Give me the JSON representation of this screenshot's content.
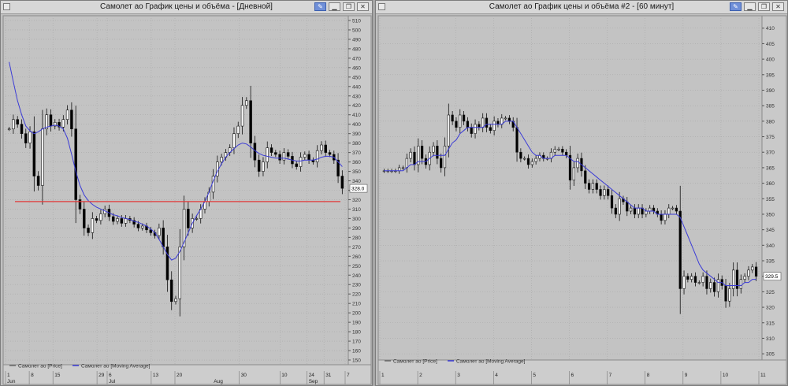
{
  "windows": [
    {
      "id": "left",
      "title": "Самолет ао График цены и объёма - [Дневной]",
      "buttons": [
        "pin-icon",
        "minimize-icon",
        "restore-icon",
        "close-icon"
      ]
    },
    {
      "id": "right",
      "title": "Самолет ао График цены и объёма #2 - [60 минут]",
      "buttons": [
        "pin-icon",
        "minimize-icon",
        "restore-icon",
        "close-icon"
      ]
    }
  ],
  "chart_data": [
    {
      "type": "line",
      "title": "",
      "ylim": [
        145,
        515
      ],
      "yticks": [
        150,
        160,
        170,
        180,
        190,
        200,
        210,
        220,
        230,
        240,
        250,
        260,
        270,
        280,
        290,
        300,
        310,
        320,
        330,
        340,
        350,
        360,
        370,
        380,
        390,
        400,
        410,
        420,
        430,
        440,
        450,
        460,
        470,
        480,
        490,
        500,
        510
      ],
      "x_tick_labels": [
        "1",
        "8",
        "15",
        "29",
        "6",
        "13",
        "20",
        "30",
        "10",
        "24",
        "31",
        "7"
      ],
      "x_month_labels": [
        "Jun",
        "Jul",
        "Aug",
        "Sep"
      ],
      "last_price_label": "328.0",
      "support_level": 318,
      "legend": [
        {
          "name": "Самолет ао [Price]",
          "color": "#6a6a6a"
        },
        {
          "name": "Самолет ао [Moving Average]",
          "color": "#3b3bd6"
        }
      ],
      "grid": true,
      "series": [
        {
          "name": "Самолет ао [Price]",
          "color": "#000000",
          "values": [
            395,
            405,
            400,
            390,
            380,
            392,
            345,
            335,
            395,
            410,
            398,
            402,
            397,
            405,
            415,
            395,
            320,
            310,
            290,
            285,
            300,
            298,
            305,
            310,
            302,
            297,
            300,
            295,
            300,
            298,
            294,
            290,
            292,
            288,
            285,
            282,
            290,
            270,
            235,
            212,
            215,
            270,
            310,
            290,
            300,
            300,
            310,
            318,
            328,
            345,
            360,
            365,
            370,
            375,
            390,
            398,
            420,
            425,
            380,
            362,
            350,
            360,
            375,
            370,
            368,
            362,
            370,
            366,
            358,
            355,
            365,
            368,
            362,
            360,
            372,
            378,
            370,
            368,
            362,
            345,
            332
          ]
        },
        {
          "name": "Самолет ао [Moving Average]",
          "color": "#3b3bd6",
          "values": [
            466,
            445,
            425,
            410,
            398,
            393,
            390,
            392,
            395,
            397,
            398,
            399,
            398,
            395,
            385,
            368,
            350,
            335,
            325,
            319,
            315,
            312,
            310,
            308,
            306,
            304,
            303,
            301,
            300,
            299,
            297,
            296,
            294,
            292,
            289,
            285,
            278,
            270,
            262,
            256,
            258,
            265,
            275,
            285,
            295,
            303,
            310,
            318,
            328,
            340,
            350,
            358,
            365,
            370,
            374,
            378,
            380,
            379,
            376,
            372,
            369,
            367,
            366,
            365,
            364,
            364,
            364,
            363,
            362,
            361,
            361,
            362,
            362,
            362,
            363,
            365,
            366,
            366,
            365,
            360,
            355
          ]
        }
      ]
    },
    {
      "type": "line",
      "title": "",
      "ylim": [
        303,
        414
      ],
      "yticks": [
        305,
        310,
        315,
        320,
        325,
        330,
        335,
        340,
        345,
        350,
        355,
        360,
        365,
        370,
        375,
        380,
        385,
        390,
        395,
        400,
        405,
        410
      ],
      "x_tick_labels": [
        "1",
        "2",
        "3",
        "4",
        "5",
        "6",
        "7",
        "8",
        "9",
        "10",
        "11"
      ],
      "last_price_label": "329.5",
      "legend": [
        {
          "name": "Самолет ао [Price]",
          "color": "#6a6a6a"
        },
        {
          "name": "Самолет ао [Moving Average]",
          "color": "#3b3bd6"
        }
      ],
      "grid": true,
      "series": [
        {
          "name": "Самолет ао [Price]",
          "color": "#000000",
          "values": [
            364,
            364,
            364,
            364,
            365,
            365,
            368,
            370,
            366,
            372,
            368,
            366,
            370,
            372,
            368,
            365,
            372,
            382,
            380,
            378,
            382,
            380,
            378,
            376,
            379,
            378,
            381,
            378,
            377,
            380,
            379,
            381,
            381,
            380,
            378,
            370,
            368,
            368,
            366,
            367,
            368,
            369,
            368,
            368,
            370,
            371,
            371,
            370,
            369,
            361,
            365,
            368,
            364,
            360,
            358,
            360,
            358,
            356,
            358,
            356,
            352,
            350,
            355,
            354,
            351,
            352,
            350,
            352,
            350,
            351,
            352,
            351,
            350,
            348,
            350,
            352,
            352,
            351,
            326,
            330,
            329,
            330,
            328,
            328,
            330,
            326,
            328,
            325,
            329,
            327,
            322,
            326,
            332,
            326,
            329,
            330,
            332,
            333,
            330
          ]
        },
        {
          "name": "Самолет ао [Moving Average]",
          "color": "#3b3bd6",
          "values": [
            364,
            364,
            364,
            364,
            364,
            364,
            365,
            366,
            366,
            367,
            367,
            367,
            368,
            369,
            369,
            369,
            369,
            371,
            373,
            374,
            376,
            377,
            378,
            378,
            378,
            378,
            378,
            379,
            379,
            379,
            379,
            379,
            380,
            380,
            380,
            378,
            376,
            374,
            372,
            370,
            369,
            369,
            368,
            368,
            368,
            369,
            369,
            369,
            369,
            368,
            367,
            367,
            366,
            365,
            364,
            363,
            362,
            361,
            360,
            359,
            358,
            357,
            356,
            355,
            354,
            353,
            352,
            352,
            352,
            351,
            351,
            351,
            350,
            350,
            350,
            350,
            350,
            350,
            349,
            346,
            343,
            340,
            337,
            334,
            332,
            331,
            330,
            329,
            328,
            328,
            327,
            327,
            327,
            327,
            327,
            328,
            328,
            329,
            329
          ]
        }
      ]
    }
  ]
}
